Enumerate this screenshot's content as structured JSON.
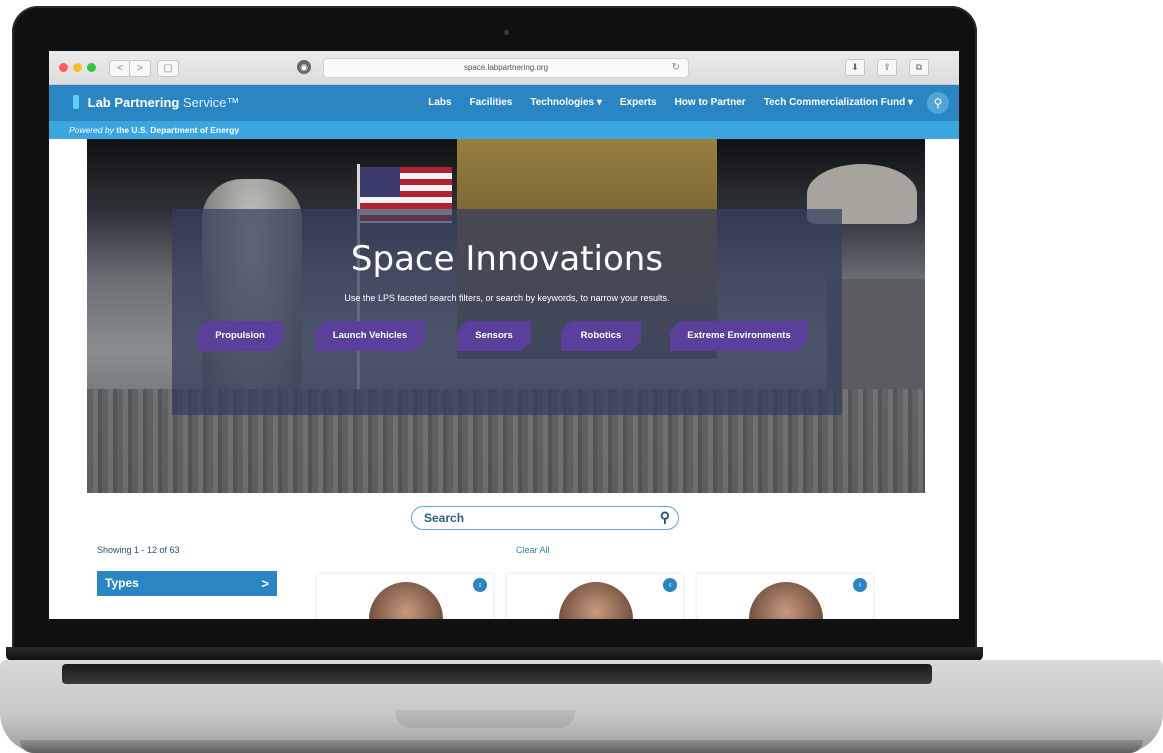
{
  "browser": {
    "url": "space.labpartnering.org",
    "nav_back": "<",
    "nav_forward": ">",
    "sidebar_toggle": "▢",
    "extension_icon": "◉",
    "reload_icon": "↻",
    "toolbar": [
      "⬇",
      "⇪",
      "⧉"
    ]
  },
  "site": {
    "logo_main": "Lab Partnering",
    "logo_service": "Service™",
    "nav": [
      "Labs",
      "Facilities",
      "Technologies ▾",
      "Experts",
      "How to Partner",
      "Tech Commercialization Fund ▾"
    ],
    "search_icon": "⚲",
    "powered_prefix": "Powered by",
    "powered_org": "the U.S. Department of Energy"
  },
  "hero": {
    "title": "Space Innovations",
    "subtitle": "Use the LPS faceted search filters, or search by keywords, to narrow your results.",
    "categories": [
      "Propulsion",
      "Launch Vehicles",
      "Sensors",
      "Robotics",
      "Extreme Environments"
    ]
  },
  "results": {
    "search_placeholder": "Search",
    "search_icon": "⚲",
    "showing": "Showing 1 - 12 of 63",
    "clear_all": "Clear All",
    "types_label": "Types",
    "types_arrow": ">",
    "card_badge": "♁"
  },
  "colors": {
    "header_blue": "#2a86c3",
    "powered_blue": "#3aa5de",
    "category_purple": "#5b3f9a",
    "category_shadow": "#3fb0e6"
  }
}
